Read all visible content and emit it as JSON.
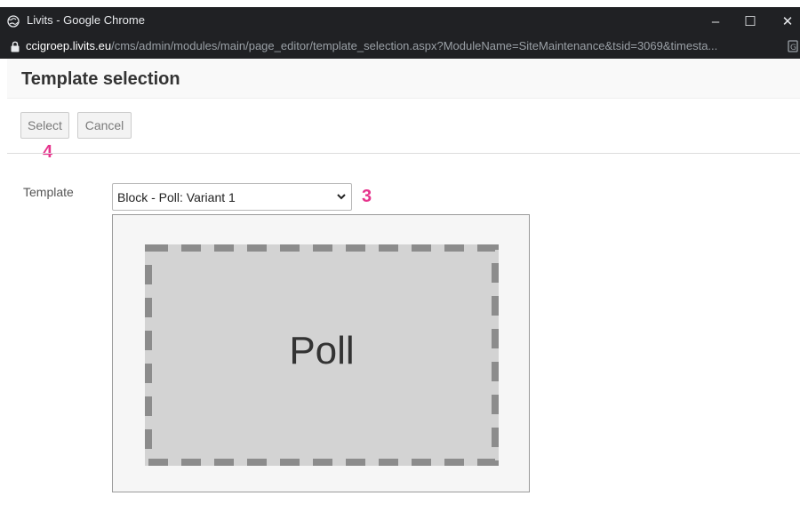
{
  "window": {
    "title": "Livits - Google Chrome",
    "controls": {
      "minimize": "–",
      "maximize": "☐",
      "close": "✕"
    }
  },
  "address_bar": {
    "host": "ccigroep.livits.eu",
    "path": "/cms/admin/modules/main/page_editor/template_selection.aspx?ModuleName=SiteMaintenance&tsid=3069&timesta..."
  },
  "page": {
    "title": "Template selection",
    "buttons": {
      "select": "Select",
      "cancel": "Cancel"
    },
    "template_label": "Template",
    "template_value": "Block - Poll: Variant 1",
    "preview_text": "Poll"
  },
  "annotations": {
    "select_step": "4",
    "template_step": "3"
  },
  "colors": {
    "annotation": "#e6338c",
    "titlebar": "#202124",
    "preview_fill": "#d3d3d3",
    "preview_dash": "#8c8c8c"
  },
  "icons": {
    "titlebar": "globe-icon",
    "address": "lock-icon",
    "select_chevron": "chevron-down-icon",
    "translate": "translate-icon"
  }
}
